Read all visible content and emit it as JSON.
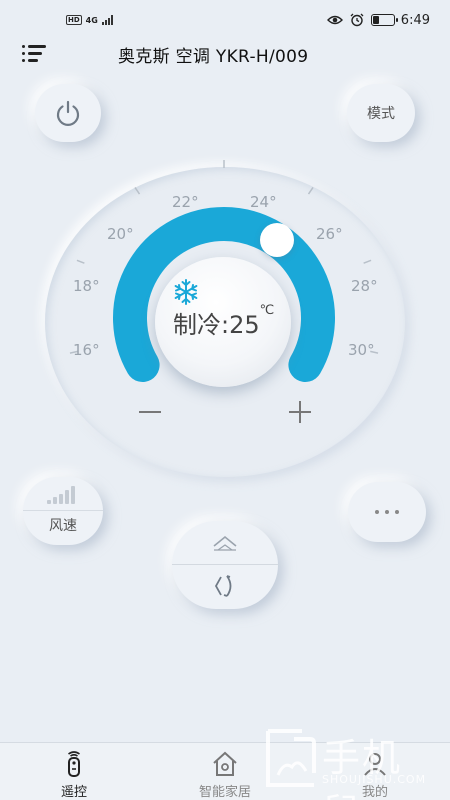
{
  "status_bar": {
    "network_badge": "HD",
    "network_type": "4G",
    "time": "6:49",
    "battery_level": 0.3,
    "icons": [
      "eye-icon",
      "alarm-icon",
      "battery-icon"
    ]
  },
  "header": {
    "title": "奥克斯 空调 YKR-H/009",
    "menu_icon": "menu-icon"
  },
  "controls": {
    "power_icon": "power-icon",
    "mode_label": "模式",
    "wind_label": "风速",
    "more_icon": "more-icon",
    "swing_up_icon": "swing-vertical-icon",
    "swing_lr_icon": "swing-horizontal-icon"
  },
  "dial": {
    "ticks": [
      "16°",
      "18°",
      "20°",
      "22°",
      "24°",
      "26°",
      "28°",
      "30°"
    ],
    "mode_text": "制冷",
    "separator": ":",
    "temperature": "25",
    "unit": "℃",
    "min": 16,
    "max": 30,
    "value": 25,
    "accent_color": "#1aa8d8",
    "mode_icon": "snowflake-icon"
  },
  "tabs": [
    {
      "label": "遥控",
      "icon": "remote-icon",
      "active": true
    },
    {
      "label": "智能家居",
      "icon": "home-icon",
      "active": false
    },
    {
      "label": "我的",
      "icon": "profile-icon",
      "active": false
    }
  ],
  "watermark": {
    "text": "手机鼠",
    "sub": "SHOUJISHU.COM"
  }
}
